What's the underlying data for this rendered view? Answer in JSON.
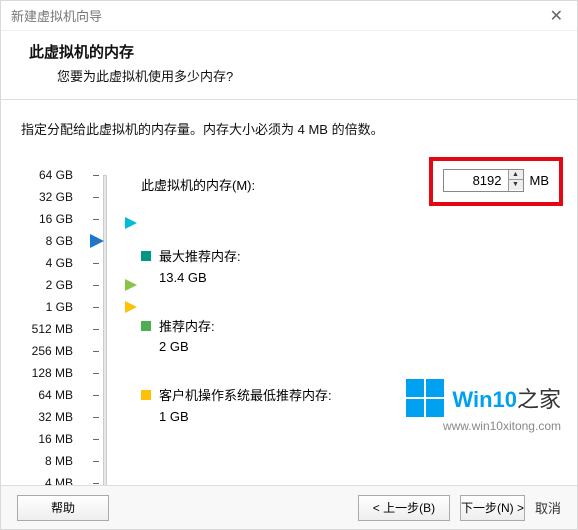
{
  "window": {
    "title": "新建虚拟机向导",
    "heading": "此虚拟机的内存",
    "subheading": "您要为此虚拟机使用多少内存?"
  },
  "instruction": "指定分配给此虚拟机的内存量。内存大小必须为 4 MB 的倍数。",
  "memory": {
    "label": "此虚拟机的内存(M):",
    "value": "8192",
    "unit": "MB"
  },
  "ruler": {
    "labels": [
      "64 GB",
      "32 GB",
      "16 GB",
      "8 GB",
      "4 GB",
      "2 GB",
      "1 GB",
      "512 MB",
      "256 MB",
      "128 MB",
      "64 MB",
      "32 MB",
      "16 MB",
      "8 MB",
      "4 MB"
    ]
  },
  "recommendations": {
    "max": {
      "label": "最大推荐内存:",
      "value": "13.4 GB"
    },
    "rec": {
      "label": "推荐内存:",
      "value": "2 GB"
    },
    "min": {
      "label": "客户机操作系统最低推荐内存:",
      "value": "1 GB"
    }
  },
  "watermark": {
    "brand_prefix": "Win10",
    "brand_suffix": "之家",
    "url": "www.win10xitong.com"
  },
  "footer": {
    "help": "帮助",
    "back": "< 上一步(B)",
    "next_partial": "下一步(N) >",
    "cancel": "取消"
  }
}
